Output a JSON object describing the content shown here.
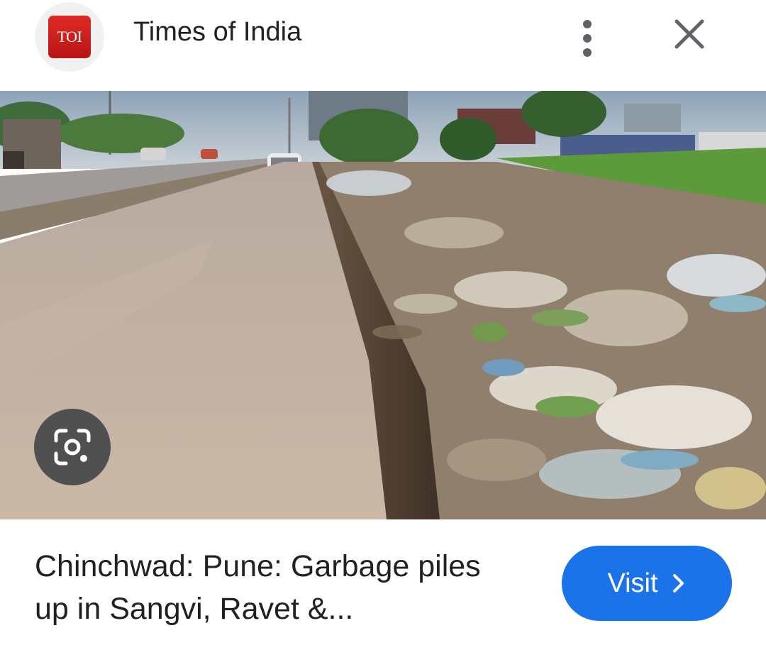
{
  "header": {
    "logo_text": "TOI",
    "source_name": "Times of India",
    "more_icon": "more-vert-icon",
    "close_icon": "close-icon"
  },
  "image": {
    "lens_icon": "google-lens-icon"
  },
  "result": {
    "title": "Chinchwad: Pune: Garbage piles up in Sangvi, Ravet &...",
    "visit_label": "Visit",
    "visit_icon": "chevron-right-icon"
  },
  "colors": {
    "accent": "#1a73e8",
    "logo_red": "#d32020",
    "text": "#202124",
    "icon_gray": "#5f6368"
  }
}
